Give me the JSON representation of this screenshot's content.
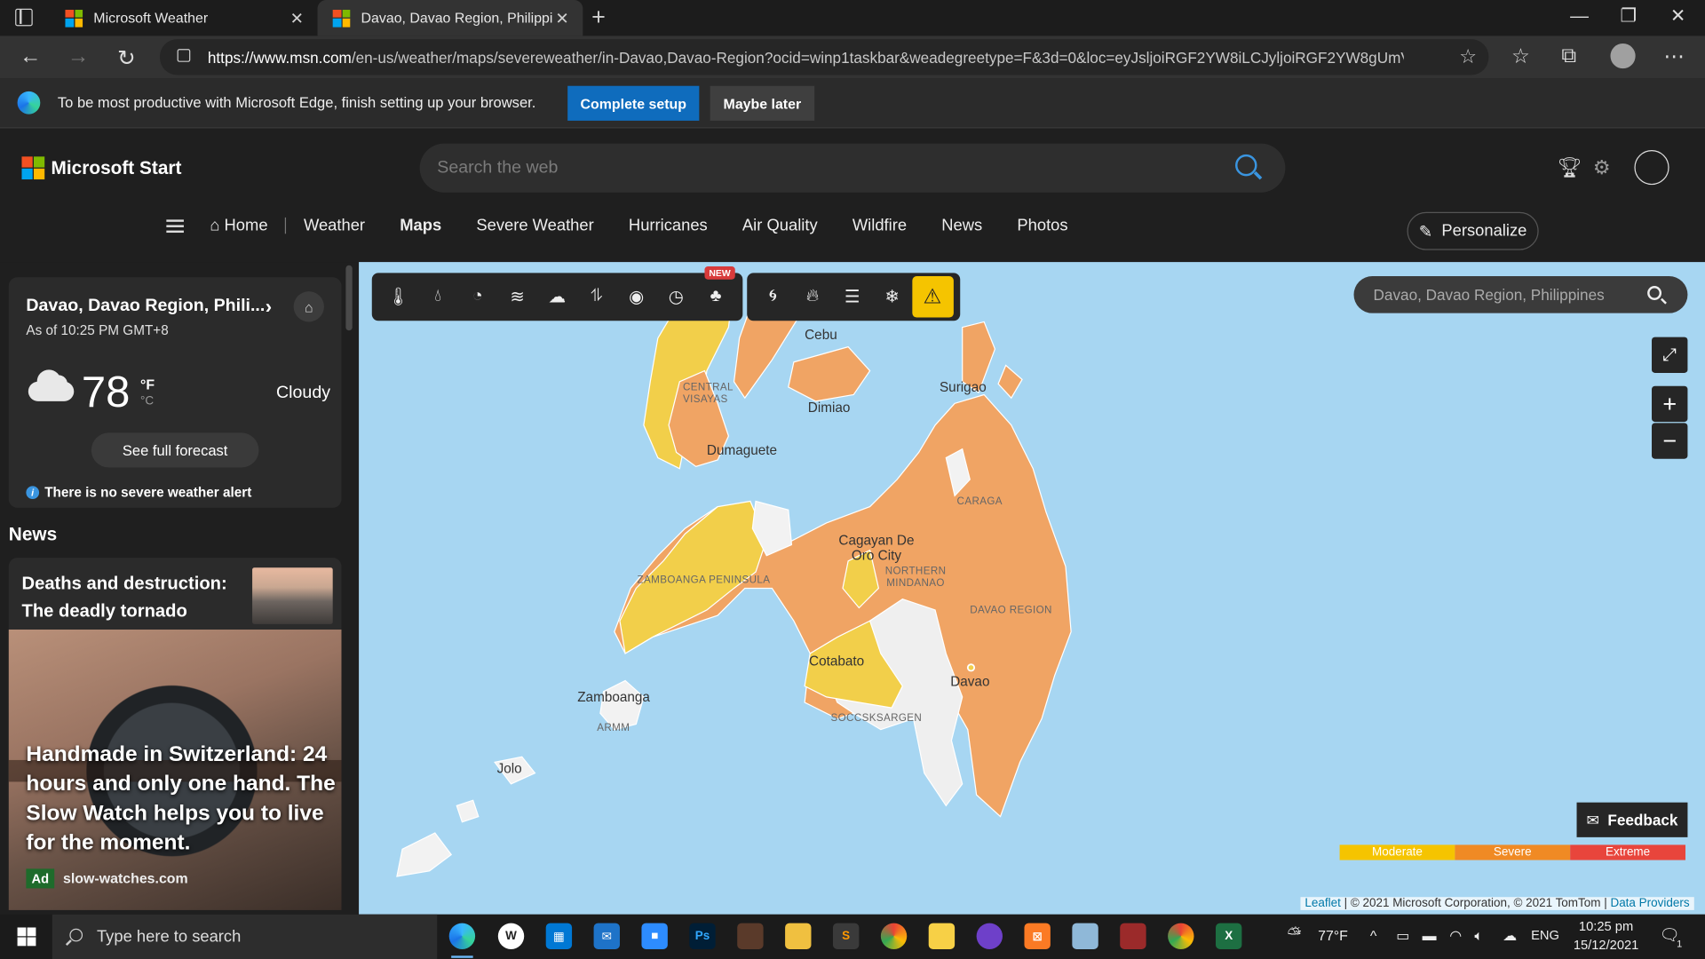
{
  "browser": {
    "tabs": [
      {
        "title": "Microsoft Weather"
      },
      {
        "title": "Davao, Davao Region, Philippine"
      }
    ],
    "url_host": "https://www.msn.com",
    "url_path": "/en-us/weather/maps/severeweather/in-Davao,Davao-Region?ocid=winp1taskbar&weadegreetype=F&3d=0&loc=eyJsljoiRGF2YW8iLCJyljoiRGF2YW8gUmV..."
  },
  "setup_banner": {
    "message": "To be most productive with Microsoft Edge, finish setting up your browser.",
    "complete_label": "Complete setup",
    "later_label": "Maybe later"
  },
  "header": {
    "brand": "Microsoft Start",
    "search_placeholder": "Search the web",
    "personalize_label": "Personalize",
    "nav": [
      "Home",
      "Weather",
      "Maps",
      "Severe Weather",
      "Hurricanes",
      "Air Quality",
      "Wildfire",
      "News",
      "Photos"
    ]
  },
  "weather_card": {
    "location": "Davao, Davao Region, Phili...",
    "as_of": "As of 10:25 PM GMT+8",
    "temperature": "78",
    "unit_f": "°F",
    "unit_c": "°C",
    "condition": "Cloudy",
    "forecast_label": "See full forecast",
    "alert_text": "There is no severe weather alert"
  },
  "news": {
    "heading": "News",
    "item_title": "Deaths and destruction: The deadly tornado",
    "ad_title": "Handmade in Switzerland: 24 hours and only one hand. The Slow Watch helps you to live for the moment.",
    "ad_badge": "Ad",
    "ad_source": "slow-watches.com"
  },
  "map": {
    "toolbar_new_badge": "NEW",
    "search_placeholder": "Davao, Davao Region, Philippines",
    "feedback_label": "Feedback",
    "legend": [
      {
        "label": "Moderate",
        "color": "#f5c400"
      },
      {
        "label": "Severe",
        "color": "#f08a24"
      },
      {
        "label": "Extreme",
        "color": "#e8453c"
      }
    ],
    "attribution_leaflet": "Leaflet",
    "attribution_text": " | © 2021 Microsoft Corporation, © 2021 TomTom | ",
    "attribution_providers": "Data Providers",
    "places": [
      "Cebu",
      "Surigao",
      "Dimiao",
      "Dumaguete",
      "Cagayan De Oro City",
      "Cotabato",
      "Davao",
      "Zamboanga",
      "Jolo"
    ],
    "regions": [
      "CENTRAL VISAYAS",
      "CARAGA",
      "NORTHERN MINDANAO",
      "ZAMBOANGA PENINSULA",
      "DAVAO REGION",
      "SOCCSKSARGEN",
      "ARMM"
    ]
  },
  "taskbar": {
    "search_placeholder": "Type here to search",
    "weather": "77°F",
    "lang": "ENG",
    "time": "10:25 pm",
    "date": "15/12/2021",
    "notif_count": "1"
  }
}
